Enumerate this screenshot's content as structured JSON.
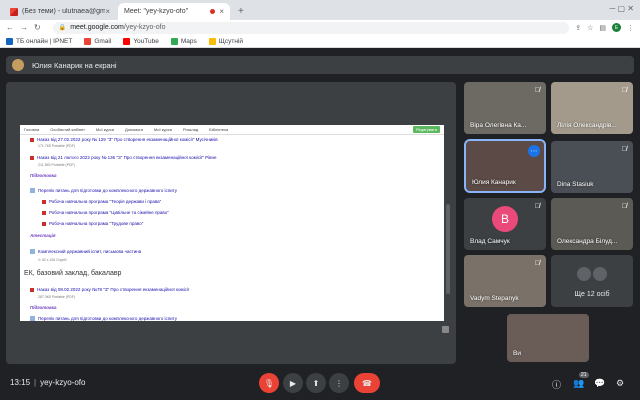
{
  "browser": {
    "tabs": [
      {
        "title": "(Без теми) - ulutnaea@gmai...",
        "close": "×"
      },
      {
        "title": "Meet: \"yey-kzyo-ofo\"",
        "close": "×"
      }
    ],
    "new_tab": "+",
    "address": {
      "host": "meet.google.com",
      "path": "/yey-kzyo-ofo"
    },
    "profile_letter": "E",
    "bookmarks": [
      {
        "label": "ТБ онлайн | IPNET"
      },
      {
        "label": "Gmail"
      },
      {
        "label": "YouTube"
      },
      {
        "label": "Maps"
      },
      {
        "label": "Щсутній"
      }
    ]
  },
  "meet": {
    "presenter_banner": "Юлия Канарик на екрані",
    "document": {
      "nav": [
        "Головна",
        "Особистий кабінет",
        "Мої курси",
        "Допомога",
        "Мої курси",
        "Розклад",
        "Бібліотека"
      ],
      "edit_label": "Редагувати",
      "rows": [
        {
          "kind": "link",
          "text": "Наказ від 27.02.2022 року № 129 \"З\" Про створення екзаменаційної комісії\" Мусічників"
        },
        {
          "kind": "meta",
          "text": "171.7Кб Portable (PDF)"
        },
        {
          "kind": "link",
          "text": "Наказ від 21 лютого 2022 року № 136 \"З\" Про створення екзаменаційної комісії\" Рівне"
        },
        {
          "kind": "meta",
          "text": "211.3Кб Portable (PDF)"
        },
        {
          "kind": "section",
          "text": "Підготовка"
        },
        {
          "kind": "link",
          "text": "Перелік питань для підготовки до комплексного державного іспиту"
        },
        {
          "kind": "sub",
          "text": "Робоча навчальна програма \"Теорія держави і права\""
        },
        {
          "kind": "sub",
          "text": "Робоча навчальна програма \"Цивільне та сімейне право\""
        },
        {
          "kind": "sub",
          "text": "Робоча навчальна програма \"Трудове право\""
        },
        {
          "kind": "section",
          "text": "Атестація"
        },
        {
          "kind": "link",
          "text": "Комплексний державний іспит, письмова частина"
        },
        {
          "kind": "meta",
          "text": "⊙ 92 з 126 Спроб"
        },
        {
          "kind": "title",
          "text": "ЕК, базовий заклад, бакалавр"
        },
        {
          "kind": "link",
          "text": "Наказ від 08.02.2022 року №78 \"З\" Про створення екзаменаційної комісії"
        },
        {
          "kind": "meta",
          "text": "287.3Кб Portable (PDF)"
        },
        {
          "kind": "section",
          "text": "Підготовка"
        },
        {
          "kind": "link",
          "text": "Перелік питань для підготовки до комплексного державного іспиту"
        }
      ]
    },
    "participants": [
      {
        "name": "Віра Олегівна Ка...",
        "muted": true
      },
      {
        "name": "Лілія Олександрів...",
        "muted": true
      },
      {
        "name": "Юлия Канарик",
        "muted": false,
        "active": true,
        "more": "⋯"
      },
      {
        "name": "Dina Stasiuk",
        "muted": true
      },
      {
        "name": "Влад Самчук",
        "muted": true,
        "initial": "В"
      },
      {
        "name": "Олександра Білуд...",
        "muted": true
      },
      {
        "name": "Vadym Stepanyk",
        "muted": true
      },
      {
        "name": "Ще 12 осіб",
        "others": true
      },
      {
        "name": "Ви",
        "self": true
      }
    ],
    "bottom": {
      "time": "13:15",
      "meeting_code": "yey-kzyo-ofo",
      "participant_count": "21"
    }
  },
  "colors": {
    "bg": "#202124",
    "tile": "#3c4043",
    "accent_blue": "#1a73e8",
    "danger": "#ea4335"
  }
}
